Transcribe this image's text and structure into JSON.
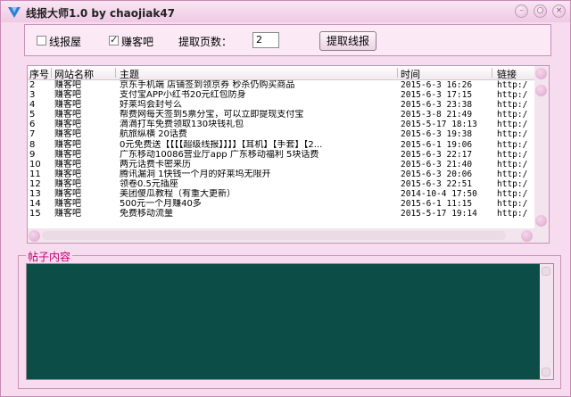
{
  "window": {
    "title": "线报大师1.0 by chaojiak47"
  },
  "toolbar": {
    "opt_xianbaowu": "线报屋",
    "opt_zhuankeba": "赚客吧",
    "opt_xianbaowu_checked": false,
    "opt_zhuankeba_checked": true,
    "pages_label": "提取页数：",
    "pages_value": "2",
    "fetch_label": "提取线报"
  },
  "table": {
    "columns": [
      "序号",
      "网站名称",
      "主题",
      "时间",
      "链接"
    ],
    "rows": [
      {
        "no": "2",
        "site": "赚客吧",
        "topic": "京东手机端 店铺签到领京券 秒杀仍购买商品",
        "time": "2015-6-3 16:26",
        "link": "http:/"
      },
      {
        "no": "3",
        "site": "赚客吧",
        "topic": "支付宝APP小红书20元红包防身",
        "time": "2015-6-3 17:15",
        "link": "http:/"
      },
      {
        "no": "4",
        "site": "赚客吧",
        "topic": "好莱坞会封号么",
        "time": "2015-6-3 23:38",
        "link": "http:/"
      },
      {
        "no": "5",
        "site": "赚客吧",
        "topic": "帮费网每天签到5票分宝，可以立即提现支付宝",
        "time": "2015-3-8 21:49",
        "link": "http:/"
      },
      {
        "no": "6",
        "site": "赚客吧",
        "topic": "滴滴打车免费领取130块钱礼包",
        "time": "2015-5-17 18:13",
        "link": "http:/"
      },
      {
        "no": "7",
        "site": "赚客吧",
        "topic": "航旅纵横  20话费",
        "time": "2015-6-3 19:38",
        "link": "http:/"
      },
      {
        "no": "8",
        "site": "赚客吧",
        "topic": "0元免费送【【【【超级线报】】】】【耳机】【手套】【2...",
        "time": "2015-6-1 19:06",
        "link": "http:/"
      },
      {
        "no": "9",
        "site": "赚客吧",
        "topic": "广东移动10086营业厅app  广东移动福利  5块话费",
        "time": "2015-6-3 22:17",
        "link": "http:/"
      },
      {
        "no": "10",
        "site": "赚客吧",
        "topic": "两元话费卡密来历",
        "time": "2015-6-3 21:40",
        "link": "http:/"
      },
      {
        "no": "11",
        "site": "赚客吧",
        "topic": "腾讯漏洞    1快钱一个月的好莱坞无限开",
        "time": "2015-6-3 20:06",
        "link": "http:/"
      },
      {
        "no": "12",
        "site": "赚客吧",
        "topic": "领卷0.5元插座",
        "time": "2015-6-3 22:51",
        "link": "http:/"
      },
      {
        "no": "13",
        "site": "赚客吧",
        "topic": "美团傻瓜教程（有重大更新）",
        "time": "2014-10-4 17:50",
        "link": "http:/"
      },
      {
        "no": "14",
        "site": "赚客吧",
        "topic": "500元一个月赚40多",
        "time": "2015-6-1 11:15",
        "link": "http:/"
      },
      {
        "no": "15",
        "site": "赚客吧",
        "topic": "免费移动流量",
        "time": "2015-5-17 19:14",
        "link": "http:/"
      }
    ]
  },
  "content_panel": {
    "label": "帖子内容",
    "background": "#0d4d47"
  },
  "colors": {
    "accent": "#c00070",
    "window_bg": "#f6dcee"
  }
}
